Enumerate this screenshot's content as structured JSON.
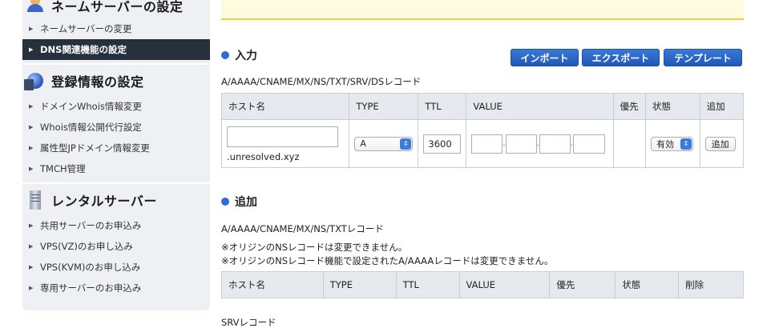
{
  "sidebar": {
    "sections": [
      {
        "title": "ネームサーバーの設定",
        "icon": "user-icon"
      },
      {
        "title": "登録情報の設定",
        "icon": "globe-book-icon"
      },
      {
        "title": "レンタルサーバー",
        "icon": "server-icon"
      }
    ],
    "items_ns": [
      "ネームサーバーの変更",
      "DNS関連機能の設定"
    ],
    "items_reg": [
      "ドメインWhois情報変更",
      "Whois情報公開代行設定",
      "属性型JPドメイン情報変更",
      "TMCH管理"
    ],
    "items_rental": [
      "共用サーバーのお申込み",
      "VPS(VZ)のお申し込み",
      "VPS(KVM)のお申し込み",
      "専用サーバーのお申込み"
    ],
    "active_item": "DNS関連機能の設定"
  },
  "input_section": {
    "heading": "入力",
    "buttons": [
      "インポート",
      "エクスポート",
      "テンプレート"
    ],
    "caption": "A/AAAA/CNAME/MX/NS/TXT/SRV/DSレコード",
    "columns": [
      "ホスト名",
      "TYPE",
      "TTL",
      "VALUE",
      "優先",
      "状態",
      "追加"
    ],
    "host_value": "",
    "domain_suffix": ".unresolved.xyz",
    "type_value": "A",
    "ttl_value": "3600",
    "value_sep": ".",
    "status_value": "有効",
    "add_button": "追加"
  },
  "add_section": {
    "heading": "追加",
    "caption": "A/AAAA/CNAME/MX/NS/TXTレコード",
    "note1": "※オリジンのNSレコードは変更できません。",
    "note2": "※オリジンのNSレコード機能で設定されたA/AAAAレコードは変更できません。",
    "columns": [
      "ホスト名",
      "TYPE",
      "TTL",
      "VALUE",
      "優先",
      "状態",
      "削除"
    ]
  },
  "srv_caption": "SRVレコード",
  "colors": {
    "accent": "#2d6bd6",
    "sidebar_active": "#27313d",
    "notice_border": "#f0cf3a"
  }
}
